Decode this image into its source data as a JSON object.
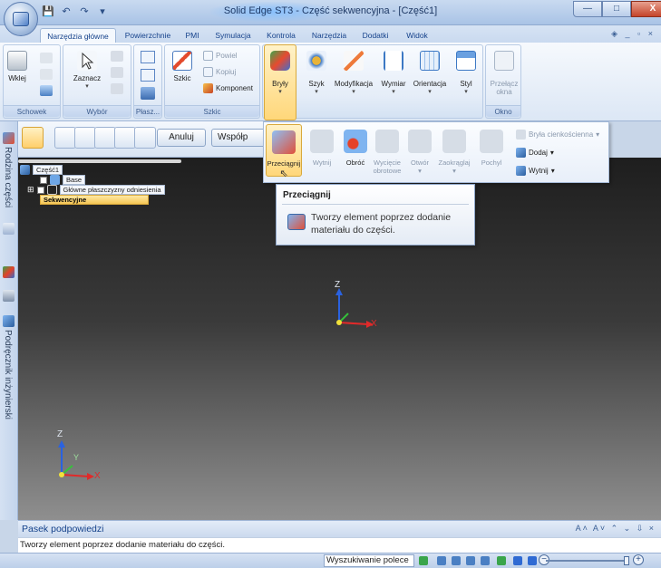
{
  "window": {
    "title": "Solid Edge ST3 - Część sekwencyjna - [Część1]",
    "controls": {
      "minimize": "—",
      "maximize": "□",
      "close": "X"
    }
  },
  "quick_access": [
    "save-icon",
    "undo-icon",
    "redo-icon",
    "dropdown-icon"
  ],
  "tabs": [
    {
      "label": "Narzędzia główne",
      "active": true
    },
    {
      "label": "Powierzchnie"
    },
    {
      "label": "PMI"
    },
    {
      "label": "Symulacja"
    },
    {
      "label": "Kontrola"
    },
    {
      "label": "Narzędzia"
    },
    {
      "label": "Dodatki"
    },
    {
      "label": "Widok"
    }
  ],
  "tab_right_icons": "◈ _ ▫ ×",
  "ribbon": {
    "groups": [
      {
        "label": "Schowek",
        "buttons": [
          "Wklej"
        ]
      },
      {
        "label": "Wybór",
        "buttons": [
          "Zaznacz"
        ]
      },
      {
        "label": "Płasz...",
        "buttons": []
      },
      {
        "label": "Szkic",
        "buttons": [
          "Szkic"
        ],
        "small": [
          "Powiel",
          "Kopiuj",
          "Komponent"
        ]
      },
      {
        "label": "",
        "buttons": [
          "Bryły",
          "Szyk",
          "Modyfikacja",
          "Wymiar",
          "Orientacja",
          "Styl"
        ]
      },
      {
        "label": "Okno",
        "buttons": [
          "Przełącz",
          "okna"
        ]
      }
    ]
  },
  "gallery": {
    "items": [
      "Przeciągnij",
      "Wytnij",
      "Obróć",
      "Wycięcie",
      "obrotowe",
      "Otwór",
      "Zaokrąglaj",
      "Pochyl"
    ],
    "side": [
      "Bryła cienkościenna",
      "Dodaj",
      "Wytnij"
    ]
  },
  "tooltip": {
    "title": "Przeciągnij",
    "body": "Tworzy element poprzez dodanie materiału do części."
  },
  "left_strip": {
    "top_label": "Rodzina części",
    "bottom_label": "Podręcznik inżynierski"
  },
  "command_bar": {
    "cancel": "Anuluj",
    "coord": "Współp"
  },
  "tree": {
    "root": "Część1",
    "items": [
      "Base",
      "Główne płaszczyzny odniesienia",
      "Sekwencyjne"
    ]
  },
  "axes": {
    "x": "X",
    "y": "Y",
    "z": "Z"
  },
  "prompt": {
    "title": "Pasek podpowiedzi",
    "controls": "A˄ A˅ ⌃ ⌄ ⇩ ×",
    "text": "Tworzy element poprzez dodanie materiału do części."
  },
  "status": {
    "command_search": "Wyszukiwanie polece"
  }
}
